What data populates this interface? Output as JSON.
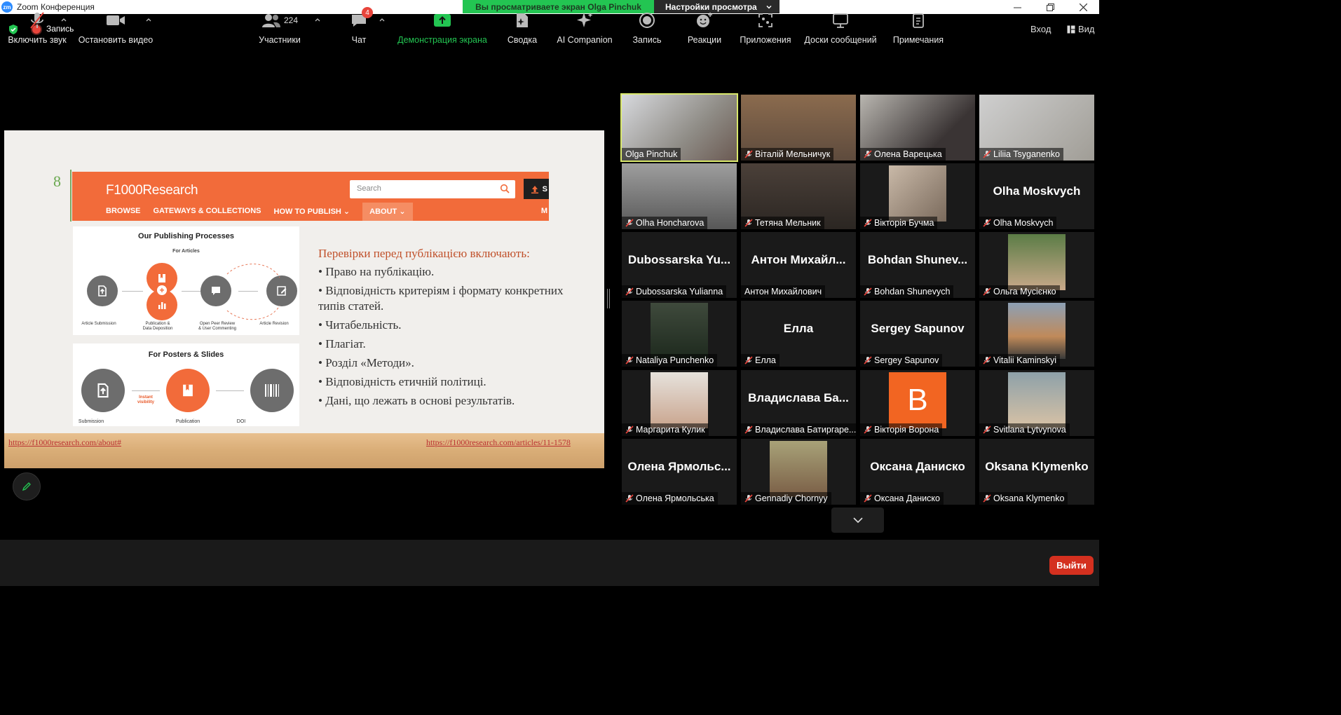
{
  "window": {
    "app_icon": "zm",
    "title": "Zoom Конференция"
  },
  "share_banner": {
    "viewing_text": "Вы просматриваете экран Olga  Pinchuk",
    "settings_label": "Настройки просмотра"
  },
  "meeting_bar": {
    "record_label": "Запись",
    "enter_label": "Вход",
    "view_label": "Вид"
  },
  "slide": {
    "number": "8",
    "site": {
      "logo": "F1000Research",
      "search_placeholder": "Search",
      "submit_label": "S",
      "nav": [
        "BROWSE",
        "GATEWAYS & COLLECTIONS",
        "HOW TO PUBLISH",
        "ABOUT"
      ],
      "nav_more": "M"
    },
    "process_panel": {
      "title": "Our Publishing Processes",
      "subtitle": "For Articles",
      "steps": [
        "Article Submission",
        "Publication &\nData Deposition",
        "Open Peer Review\n& User Commenting",
        "Article Revision"
      ]
    },
    "posters_panel": {
      "title": "For Posters & Slides",
      "steps": [
        "Submission",
        "Publication",
        "DOI"
      ],
      "instant": "Instant\nvisibility"
    },
    "heading": "Перевірки перед публікацією включають:",
    "bullets": [
      "• Право на публікацію.",
      "• Відповідність критеріям і формату конкретних типів статей.",
      "• Читабельність.",
      "• Плагіат.",
      "• Розділ «Методи».",
      "• Відповідність етичній політиці.",
      "• Дані, що лежать в основі результатів."
    ],
    "link_left": "https://f1000research.com/about#",
    "link_right": "https://f1000research.com/articles/11-1578"
  },
  "participants": [
    {
      "name": "Olga  Pinchuk",
      "muted": false,
      "kind": "video",
      "speaking": true
    },
    {
      "name": "Віталій Мельничук",
      "muted": true,
      "kind": "video"
    },
    {
      "name": "Олена Варецька",
      "muted": true,
      "kind": "video"
    },
    {
      "name": "Liliia Tsyganenko",
      "muted": true,
      "kind": "video"
    },
    {
      "name": "Olha Honcharova",
      "muted": true,
      "kind": "video"
    },
    {
      "name": "Тетяна Мельник",
      "muted": true,
      "kind": "video"
    },
    {
      "name": "Вікторія Бучма",
      "muted": true,
      "kind": "photo"
    },
    {
      "name": "Olha Moskvych",
      "muted": true,
      "kind": "name",
      "display": "Olha Moskvych"
    },
    {
      "name": "Dubossarska Yulianna",
      "muted": true,
      "kind": "name",
      "display": "Dubossarska Yu..."
    },
    {
      "name": "Антон Михайлович",
      "muted": false,
      "kind": "name",
      "display": "Антон Михайл..."
    },
    {
      "name": "Bohdan Shunevych",
      "muted": true,
      "kind": "name",
      "display": "Bohdan Shunev..."
    },
    {
      "name": "Ольга Мусієнко",
      "muted": true,
      "kind": "photo"
    },
    {
      "name": "Nataliya Punchenko",
      "muted": true,
      "kind": "photo"
    },
    {
      "name": "Елла",
      "muted": true,
      "kind": "name",
      "display": "Елла"
    },
    {
      "name": "Sergey Sapunov",
      "muted": true,
      "kind": "name",
      "display": "Sergey Sapunov"
    },
    {
      "name": "Vitalii Kaminskyi",
      "muted": true,
      "kind": "photo"
    },
    {
      "name": "Маргарита Кулик",
      "muted": true,
      "kind": "photo"
    },
    {
      "name": "Владислава Батиргаре...",
      "muted": true,
      "kind": "name",
      "display": "Владислава Ба..."
    },
    {
      "name": "Вікторія Ворона",
      "muted": true,
      "kind": "letter",
      "display": "B"
    },
    {
      "name": "Svitlana Lytvynova",
      "muted": true,
      "kind": "photo"
    },
    {
      "name": "Олена Ярмольська",
      "muted": true,
      "kind": "name",
      "display": "Олена Ярмольс..."
    },
    {
      "name": "Gennadiy Chornyy",
      "muted": true,
      "kind": "photo"
    },
    {
      "name": "Оксана Даниско",
      "muted": true,
      "kind": "name",
      "display": "Оксана Даниско"
    },
    {
      "name": "Oksana Klymenko",
      "muted": true,
      "kind": "name",
      "display": "Oksana Klymenko"
    }
  ],
  "toolbar": {
    "unmute": "Включить звук",
    "stop_video": "Остановить видео",
    "participants_count": "224",
    "participants": "Участники",
    "chat_badge": "4",
    "chat": "Чат",
    "share": "Демонстрация экрана",
    "summary": "Сводка",
    "ai": "AI Companion",
    "record": "Запись",
    "reactions": "Реакции",
    "apps": "Приложения",
    "whiteboards": "Доски сообщений",
    "notes": "Примечания",
    "leave": "Выйти"
  },
  "colors": {
    "share_green": "#23c552",
    "leave_red": "#d4301f",
    "speaker_outline": "#d9e86b",
    "f1000_orange": "#f26b3a"
  }
}
